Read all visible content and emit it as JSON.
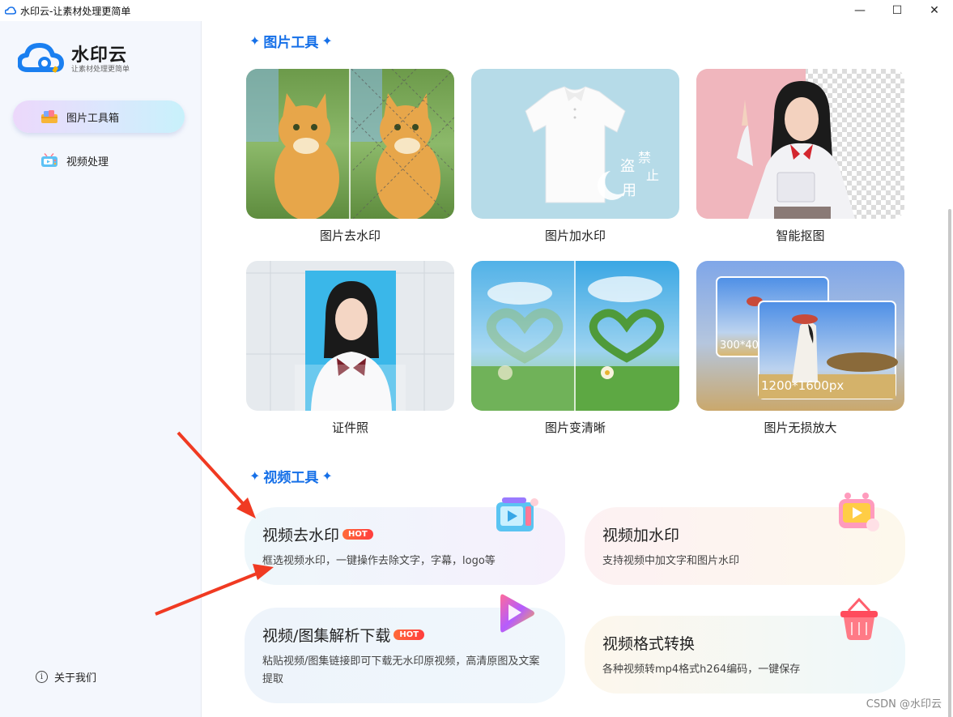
{
  "window": {
    "title": "水印云-让素材处理更简单",
    "minimize": "—",
    "maximize": "☐",
    "close": "✕"
  },
  "sidebar": {
    "logo_name": "水印云",
    "logo_tagline": "让素材处理更简单",
    "items": [
      {
        "label": "图片工具箱",
        "active": true
      },
      {
        "label": "视频处理",
        "active": false
      }
    ],
    "about_label": "关于我们"
  },
  "image_tools": {
    "title": "图片工具",
    "cards": [
      {
        "label": "图片去水印"
      },
      {
        "label": "图片加水印",
        "overlay": [
          "盗",
          "禁",
          "止",
          "用"
        ]
      },
      {
        "label": "智能抠图"
      },
      {
        "label": "证件照"
      },
      {
        "label": "图片变清晰"
      },
      {
        "label": "图片无损放大",
        "size_small": "300*40",
        "size_large": "1200*1600px"
      }
    ]
  },
  "video_tools": {
    "title": "视频工具",
    "cards": [
      {
        "title": "视频去水印",
        "badge": "HOT",
        "desc": "框选视频水印，一键操作去除文字，字幕，logo等"
      },
      {
        "title": "视频加水印",
        "badge": "",
        "desc": "支持视频中加文字和图片水印"
      },
      {
        "title": "视频/图集解析下载",
        "badge": "HOT",
        "desc": "粘贴视频/图集链接即可下载无水印原视频，高清原图及文案提取"
      },
      {
        "title": "视频格式转换",
        "badge": "",
        "desc": "各种视频转mp4格式h264编码，一键保存"
      }
    ]
  },
  "watermark_text": "CSDN @水印云",
  "colors": {
    "accent": "#1670e8",
    "hot": "#ff4a3a",
    "arrow": "#f03a22"
  }
}
